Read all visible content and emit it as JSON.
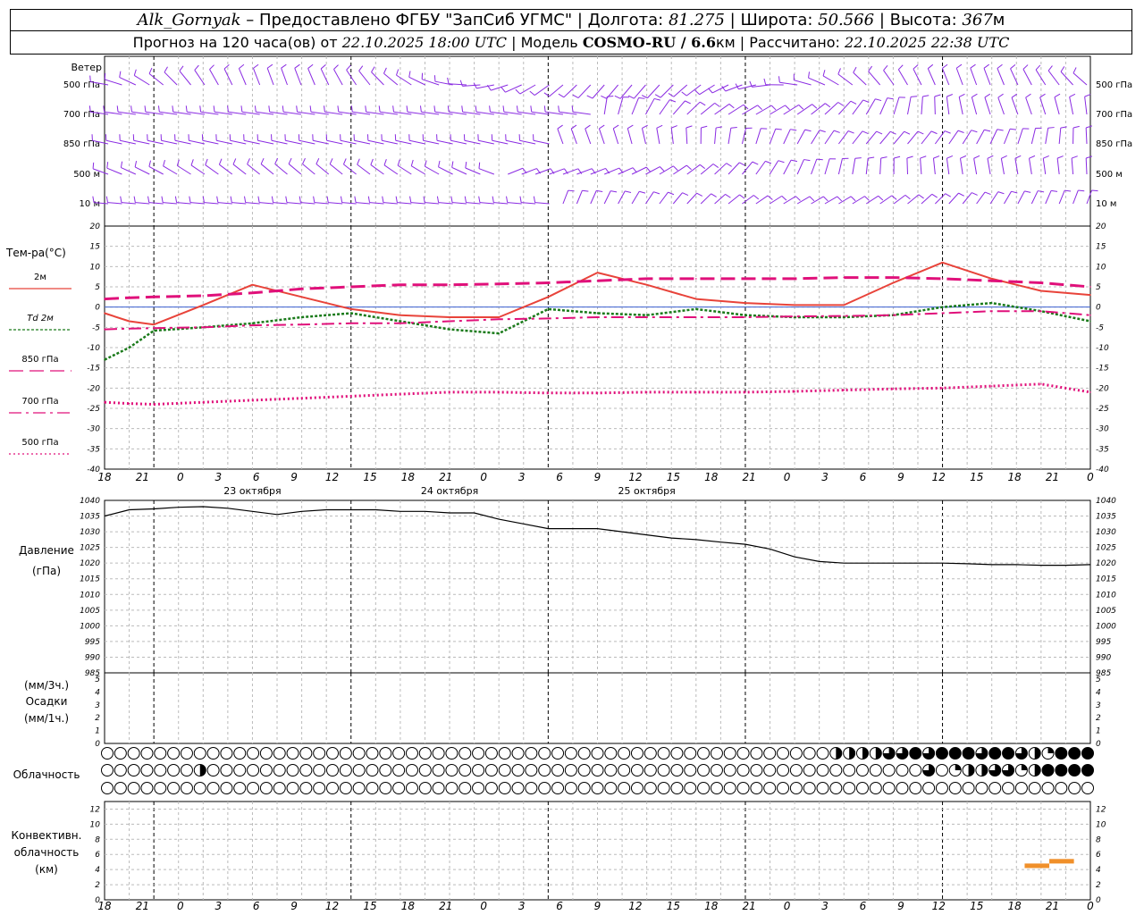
{
  "header": {
    "station": "Alk_Gornyak",
    "provided": " – Предоставлено ФГБУ \"ЗапСиб УГМС\" | Долгота: ",
    "lon": "81.275",
    "lat_label": " | Широта: ",
    "lat": "50.566",
    "alt_label": " | Высота: ",
    "alt": "367",
    "alt_unit": "м",
    "forecast_prefix": "Прогноз на 120 часа(ов) от ",
    "init_time": "22.10.2025 18:00 UTC",
    "model_label": " | Модель ",
    "model": "COSMO-RU / 6.6",
    "model_unit": "км",
    "calc_label": " | Рассчитано: ",
    "calc_time": "22.10.2025 22:38 UTC"
  },
  "labels": {
    "wind": "Ветер",
    "temp": "Тем-ра(°C)",
    "pressure": "Давление",
    "pressure_unit": "(гПа)",
    "precip_unit1": "(мм/3ч.)",
    "precip": "Осадки",
    "precip_unit2": "(мм/1ч.)",
    "clouds": "Облачность",
    "conv1": "Конвективн.",
    "conv2": "облачность",
    "conv3": "(км)"
  },
  "colors": {
    "t2m": "#e8433a",
    "td2m": "#1a7a1a",
    "t850": "#e0107a",
    "t700": "#e0107a",
    "t500": "#e0107a",
    "wind": "#8a2be2",
    "conv": "#f0902a"
  },
  "chart_data": [
    {
      "type": "wind-barbs",
      "levels": [
        "500 гПа",
        "700 гПа",
        "850 гПа",
        "500 м",
        "10  м"
      ]
    },
    {
      "type": "line",
      "title": "Тем-ра(°C)",
      "ylim": [
        -40,
        20
      ],
      "yticks": [
        20,
        15,
        10,
        5,
        0,
        -5,
        -10,
        -15,
        -20,
        -25,
        -30,
        -35,
        -40
      ],
      "xticks": [
        "18",
        "21",
        "0",
        "3",
        "6",
        "9",
        "12",
        "15",
        "18",
        "21",
        "0",
        "3",
        "6",
        "9",
        "12",
        "15",
        "18",
        "21",
        "0",
        "3",
        "6",
        "9",
        "12",
        "15",
        "18",
        "21",
        "0"
      ],
      "day_labels": [
        "23 октября",
        "24 октября",
        "25 октября"
      ],
      "hours": [
        0,
        6,
        12,
        18,
        24,
        30,
        36,
        42,
        48,
        54,
        60,
        66,
        72,
        78,
        84,
        90,
        96,
        102,
        108,
        114,
        120
      ],
      "series": [
        {
          "name": "2м",
          "style": "solid",
          "values": [
            -1.5,
            -3.5,
            -4.3,
            0.5,
            5.5,
            2.5,
            -0.5,
            -2,
            -2.5,
            -2.5,
            2.5,
            8.5,
            5.5,
            2,
            1,
            0.5,
            0.5,
            6,
            11,
            7,
            4,
            3
          ]
        },
        {
          "name": "Td  2м",
          "style": "dotted",
          "values": [
            -13,
            -10,
            -5.8,
            -5,
            -4,
            -2.5,
            -1.5,
            -3.5,
            -5.5,
            -6.5,
            -0.5,
            -1.5,
            -2,
            -0.5,
            -2,
            -2.5,
            -2.5,
            -2,
            0,
            1,
            -1,
            -3.5
          ]
        },
        {
          "name": "850 гПа",
          "style": "dashed",
          "values": [
            2,
            2.3,
            2.5,
            2.8,
            3.5,
            4.5,
            5,
            5.5,
            5.5,
            5.7,
            6,
            6.5,
            7,
            7,
            7,
            7,
            7.3,
            7.3,
            7,
            6.5,
            6,
            5
          ]
        },
        {
          "name": "700 гПа",
          "style": "dashdot",
          "values": [
            -5.5,
            -5.3,
            -5.2,
            -5,
            -4.5,
            -4.3,
            -4,
            -4,
            -3.5,
            -3,
            -2.8,
            -2.5,
            -2.5,
            -2.5,
            -2.5,
            -2.3,
            -2.2,
            -2,
            -1.5,
            -1,
            -1,
            -2
          ]
        },
        {
          "name": "500 гПа",
          "style": "dotted-pink",
          "values": [
            -23.5,
            -23.8,
            -24,
            -23.5,
            -23,
            -22.5,
            -22,
            -21.5,
            -21,
            -21,
            -21.2,
            -21.2,
            -21,
            -21,
            -21,
            -20.8,
            -20.5,
            -20.2,
            -20,
            -19.5,
            -19,
            -21
          ]
        }
      ],
      "series_hours": [
        0,
        3,
        6,
        12,
        18,
        24,
        30,
        36,
        42,
        48,
        54,
        60,
        66,
        72,
        78,
        84,
        90,
        96,
        102,
        108,
        114,
        120
      ]
    },
    {
      "type": "line",
      "title": "Давление",
      "ylabel": "(гПа)",
      "ylim": [
        985,
        1040
      ],
      "yticks": [
        1040,
        1035,
        1030,
        1025,
        1020,
        1015,
        1010,
        1005,
        1000,
        995,
        990,
        985
      ],
      "hours": [
        0,
        3,
        6,
        9,
        12,
        15,
        18,
        21,
        24,
        27,
        30,
        33,
        36,
        39,
        42,
        45,
        48,
        51,
        54,
        57,
        60,
        63,
        66,
        69,
        72,
        75,
        78,
        81,
        84,
        87,
        90,
        93,
        96,
        99,
        102,
        105,
        108,
        111,
        114,
        117,
        120
      ],
      "values": [
        1035,
        1037,
        1037.3,
        1037.8,
        1038,
        1037.5,
        1036.5,
        1035.5,
        1036.5,
        1037,
        1037,
        1037,
        1036.5,
        1036.5,
        1036,
        1036,
        1034,
        1032.5,
        1031,
        1031,
        1031,
        1030,
        1029,
        1028,
        1027.5,
        1026.7,
        1026,
        1024.5,
        1022,
        1020.5,
        1020,
        1020,
        1020,
        1020,
        1020,
        1019.8,
        1019.5,
        1019.5,
        1019.3,
        1019.3,
        1019.5
      ]
    },
    {
      "type": "bar",
      "title": "Осадки",
      "yticks": [
        5,
        4,
        3,
        2,
        1,
        0
      ],
      "values": []
    },
    {
      "type": "cloud-cover",
      "title": "Облачность",
      "rows": [
        "upper",
        "middle",
        "lower"
      ],
      "columns": 75,
      "hours_step": 1.6
    },
    {
      "type": "bar",
      "title": "Конвективн. облачность (км)",
      "ylim": [
        0,
        13
      ],
      "yticks": [
        12,
        10,
        8,
        6,
        4,
        2,
        0
      ],
      "segments": [
        {
          "from_hour": 112,
          "to_hour": 115,
          "base": 4.2,
          "top": 4.8
        },
        {
          "from_hour": 115,
          "to_hour": 118,
          "base": 4.8,
          "top": 5.4
        }
      ]
    }
  ]
}
